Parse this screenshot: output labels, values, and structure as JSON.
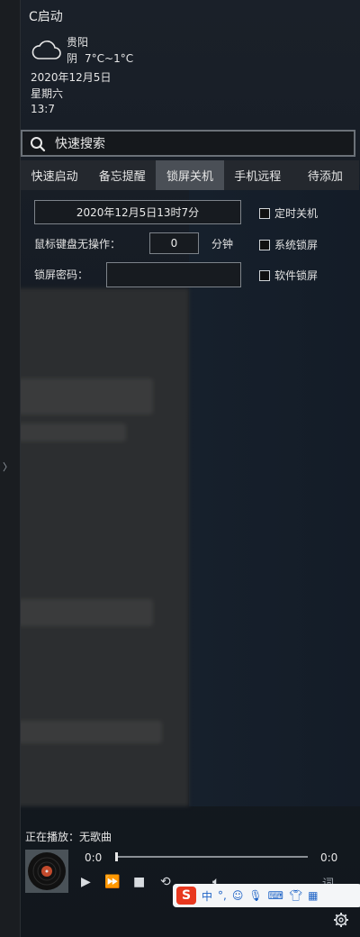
{
  "app": {
    "title": "C启动"
  },
  "weather": {
    "city": "贵阳",
    "condition": "阴",
    "temperature": "7°C~1°C",
    "date": "2020年12月5日",
    "weekday": "星期六",
    "time": "13:7"
  },
  "search": {
    "placeholder": "快速搜索"
  },
  "tabs": [
    {
      "label": "快速启动"
    },
    {
      "label": "备忘提醒"
    },
    {
      "label": "锁屏关机",
      "active": true
    },
    {
      "label": "手机远程"
    },
    {
      "label": "待添加"
    }
  ],
  "lock": {
    "datetime": "2020年12月5日13时7分",
    "idle_label": "鼠标键盘无操作：",
    "idle_value": "0",
    "idle_unit": "分钟",
    "password_label": "锁屏密码：",
    "password_value": "",
    "options": [
      {
        "label": "定时关机",
        "checked": false
      },
      {
        "label": "系统锁屏",
        "checked": false
      },
      {
        "label": "软件锁屏",
        "checked": false
      }
    ]
  },
  "player": {
    "now_playing": "正在播放：无歌曲",
    "elapsed": "0:0",
    "duration": "0:0",
    "progress": 0,
    "lyric_label": "词"
  },
  "ime": {
    "logo": "S",
    "mode": "中",
    "punct": "°,"
  },
  "icons": {
    "weather": "cloud-icon",
    "search": "search-icon",
    "settings": "gear-icon"
  }
}
